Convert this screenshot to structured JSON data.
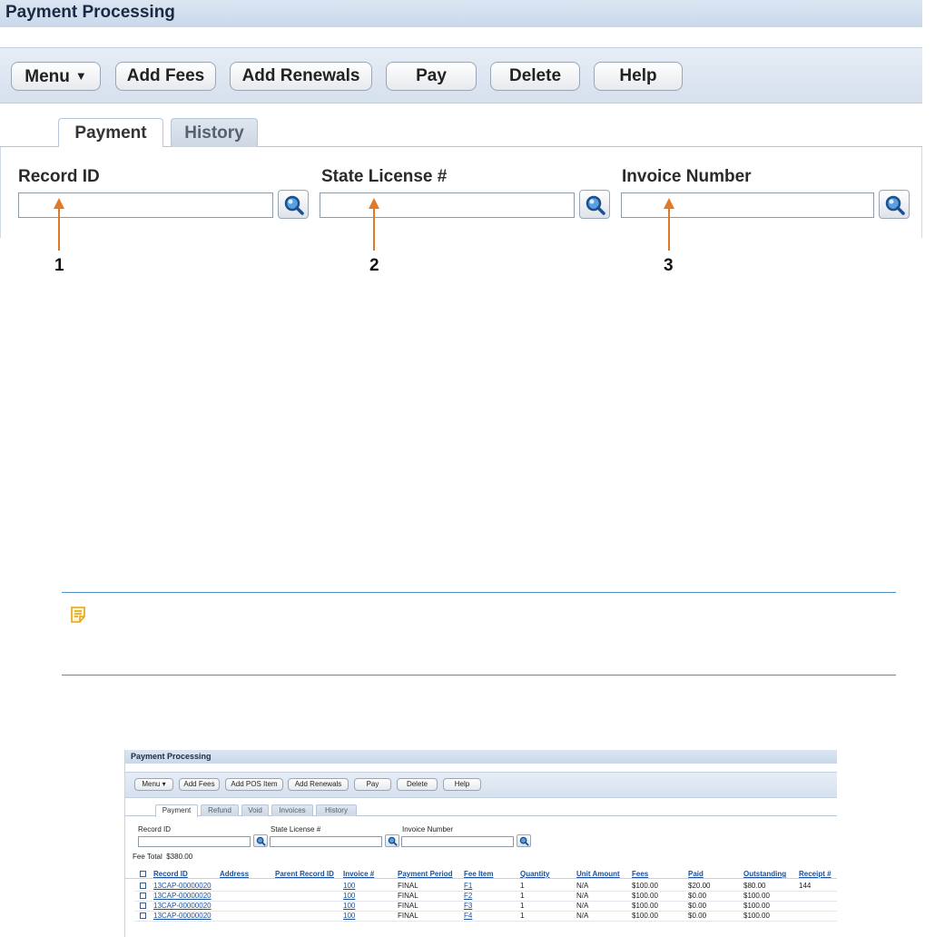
{
  "main_screen": {
    "title": "Payment Processing",
    "toolbar": {
      "menu": "Menu",
      "add_fees": "Add Fees",
      "add_renewals": "Add Renewals",
      "pay": "Pay",
      "delete": "Delete",
      "help": "Help"
    },
    "tabs": [
      {
        "label": "Payment",
        "active": true
      },
      {
        "label": "History",
        "active": false
      }
    ],
    "fields": {
      "record_id": {
        "label": "Record ID",
        "value": ""
      },
      "state_license": {
        "label": "State License #",
        "value": ""
      },
      "invoice_number": {
        "label": "Invoice Number",
        "value": ""
      }
    },
    "callouts": [
      "1",
      "2",
      "3"
    ]
  },
  "note": {
    "icon": "note-icon",
    "text": ""
  },
  "small_screen": {
    "title": "Payment Processing",
    "toolbar": {
      "menu": "Menu",
      "add_fees": "Add Fees",
      "add_pos_item": "Add POS Item",
      "add_renewals": "Add Renewals",
      "pay": "Pay",
      "delete": "Delete",
      "help": "Help"
    },
    "tabs": [
      {
        "label": "Payment",
        "active": true
      },
      {
        "label": "Refund",
        "active": false
      },
      {
        "label": "Void",
        "active": false
      },
      {
        "label": "Invoices",
        "active": false
      },
      {
        "label": "History",
        "active": false
      }
    ],
    "fields": {
      "record_id": {
        "label": "Record ID",
        "value": ""
      },
      "state_license": {
        "label": "State License #",
        "value": ""
      },
      "invoice_number": {
        "label": "Invoice Number",
        "value": ""
      }
    },
    "fee_total": {
      "label": "Fee Total",
      "value": "$380.00"
    },
    "columns": [
      "Record ID",
      "Address",
      "Parent Record ID",
      "Invoice #",
      "Payment Period",
      "Fee Item",
      "Quantity",
      "Unit Amount",
      "Fees",
      "Paid",
      "Outstanding",
      "Receipt #"
    ],
    "rows": [
      {
        "record_id": "13CAP-00000020",
        "address": "",
        "parent": "",
        "invoice": "100",
        "period": "FINAL",
        "fee_item": "F1",
        "quantity": "1",
        "unit_amount": "N/A",
        "fees": "$100.00",
        "paid": "$20.00",
        "outstanding": "$80.00",
        "receipt": "144"
      },
      {
        "record_id": "13CAP-00000020",
        "address": "",
        "parent": "",
        "invoice": "100",
        "period": "FINAL",
        "fee_item": "F2",
        "quantity": "1",
        "unit_amount": "N/A",
        "fees": "$100.00",
        "paid": "$0.00",
        "outstanding": "$100.00",
        "receipt": ""
      },
      {
        "record_id": "13CAP-00000020",
        "address": "",
        "parent": "",
        "invoice": "100",
        "period": "FINAL",
        "fee_item": "F3",
        "quantity": "1",
        "unit_amount": "N/A",
        "fees": "$100.00",
        "paid": "$0.00",
        "outstanding": "$100.00",
        "receipt": ""
      },
      {
        "record_id": "13CAP-00000020",
        "address": "",
        "parent": "",
        "invoice": "100",
        "period": "FINAL",
        "fee_item": "F4",
        "quantity": "1",
        "unit_amount": "N/A",
        "fees": "$100.00",
        "paid": "$0.00",
        "outstanding": "$100.00",
        "receipt": ""
      }
    ]
  },
  "colors": {
    "accent_blue": "#1a4f9a",
    "callout_orange": "#e07a28",
    "note_rule": "#4d8fc3",
    "note_icon": "#e8a317"
  }
}
